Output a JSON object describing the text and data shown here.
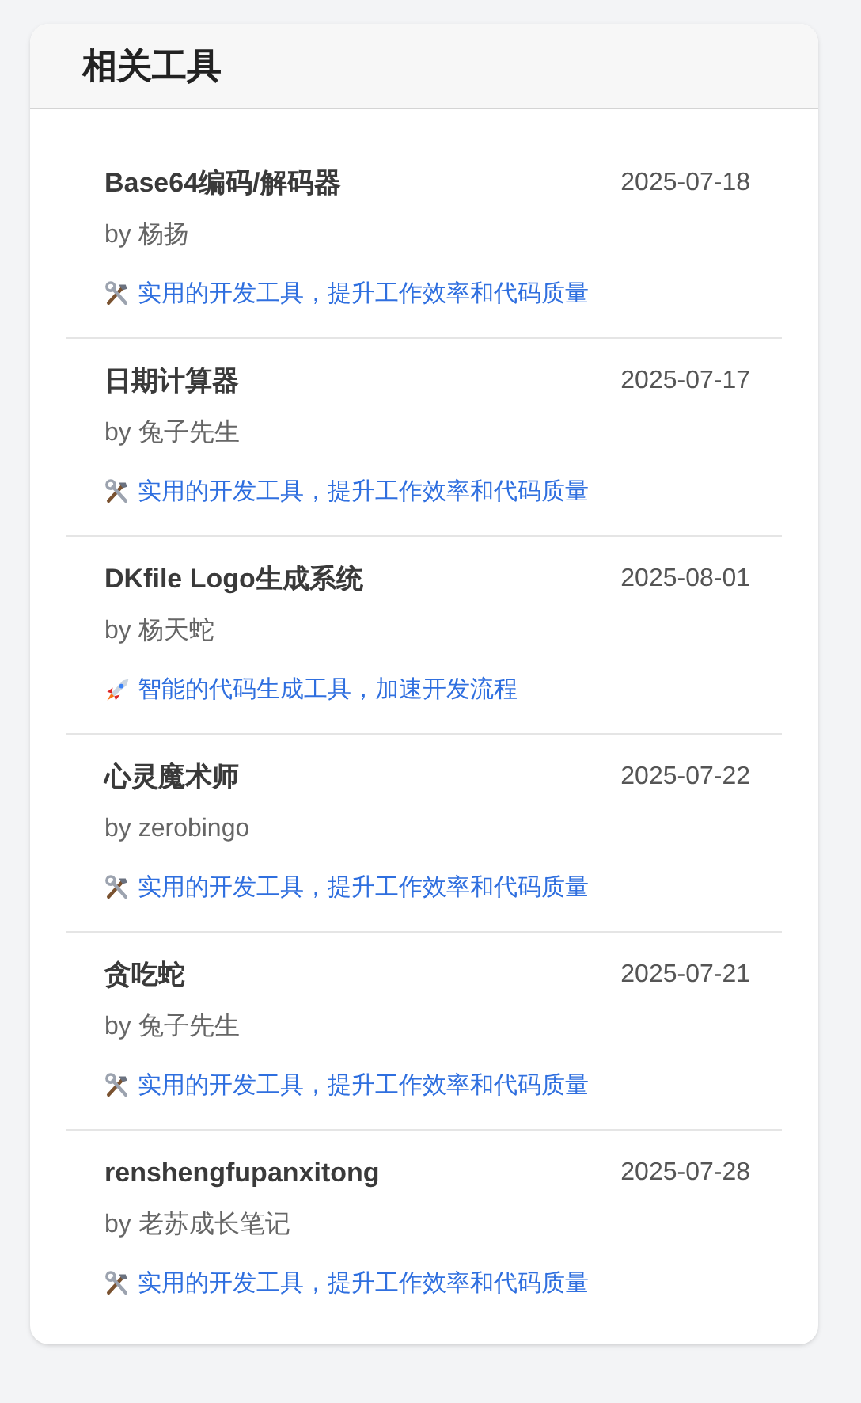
{
  "title": "相关工具",
  "tools": [
    {
      "name": "Base64编码/解码器",
      "date": "2025-07-18",
      "author": "by 杨扬",
      "kind": "tools",
      "description": "实用的开发工具，提升工作效率和代码质量"
    },
    {
      "name": "日期计算器",
      "date": "2025-07-17",
      "author": "by 兔子先生",
      "kind": "tools",
      "description": "实用的开发工具，提升工作效率和代码质量"
    },
    {
      "name": "DKfile Logo生成系统",
      "date": "2025-08-01",
      "author": "by 杨天蛇",
      "kind": "rocket",
      "description": "智能的代码生成工具，加速开发流程"
    },
    {
      "name": "心灵魔术师",
      "date": "2025-07-22",
      "author": "by zerobingo",
      "kind": "tools",
      "description": "实用的开发工具，提升工作效率和代码质量"
    },
    {
      "name": "贪吃蛇",
      "date": "2025-07-21",
      "author": "by 兔子先生",
      "kind": "tools",
      "description": "实用的开发工具，提升工作效率和代码质量"
    },
    {
      "name": "renshengfupanxitong",
      "date": "2025-07-28",
      "author": "by 老苏成长笔记",
      "kind": "tools",
      "description": "实用的开发工具，提升工作效率和代码质量"
    }
  ]
}
